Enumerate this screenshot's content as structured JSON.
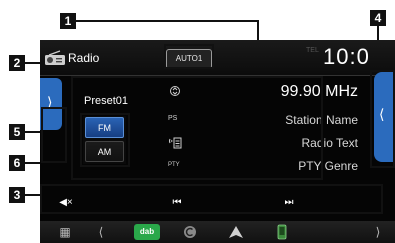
{
  "screen": {
    "source_title": "Radio",
    "seek_mode": "AUTO1",
    "tel_indicator": "TEL",
    "clock": "10:0",
    "preset_name": "Preset01",
    "frequency": "99.90 MHz",
    "rows": [
      {
        "icon": "PS",
        "value": "Station Name"
      },
      {
        "icon": "RT",
        "value": "Radio Text"
      },
      {
        "icon": "PTY",
        "value": "PTY Genre"
      }
    ],
    "bands": [
      "FM",
      "AM"
    ],
    "left_tab_glyph": "⟩",
    "right_tab_glyph": "⟨"
  },
  "controls": {
    "mute_glyph": "◀×",
    "prev_glyph": "⏮",
    "next_glyph": "⏭"
  },
  "home_bar": {
    "grid_glyph": "▦",
    "left_glyph": "⟨",
    "app_label": "dab",
    "right_glyph": "⟩"
  },
  "callouts": [
    "1",
    "2",
    "3",
    "4",
    "5",
    "6"
  ],
  "colors": {
    "accent": "#2b6bbd",
    "background": "#000000",
    "callout": "#111111"
  }
}
